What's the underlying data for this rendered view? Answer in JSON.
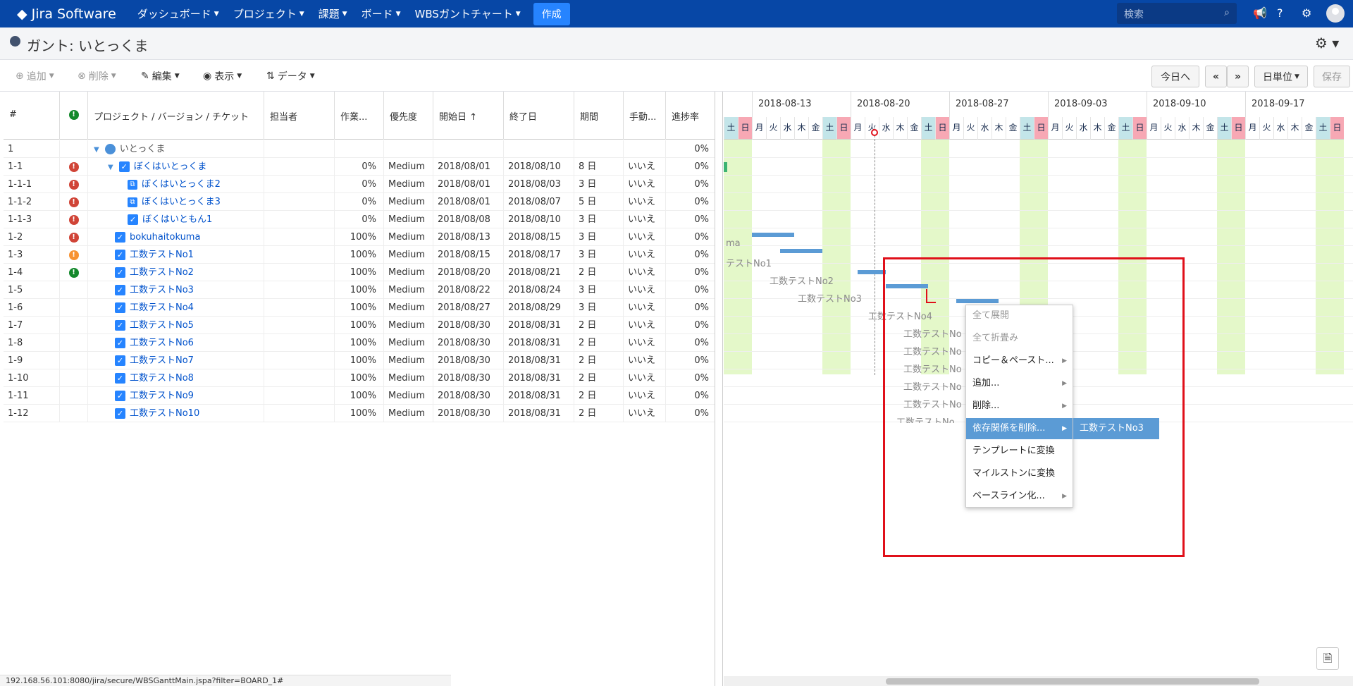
{
  "nav": {
    "logo": "Jira Software",
    "menu": [
      "ダッシュボード",
      "プロジェクト",
      "課題",
      "ボード",
      "WBSガントチャート"
    ],
    "create": "作成",
    "search_placeholder": "検索"
  },
  "page": {
    "title": "ガント: いとっくま"
  },
  "toolbar": {
    "add": "追加",
    "delete": "削除",
    "edit": "編集",
    "view": "表示",
    "data": "データ",
    "today": "今日へ",
    "prev": "«",
    "next": "»",
    "unit": "日単位",
    "save": "保存"
  },
  "grid": {
    "headers": [
      "#",
      "",
      "プロジェクト / バージョン / チケット",
      "担当者",
      "作業...",
      "優先度",
      "開始日",
      "終了日",
      "期間",
      "手動...",
      "進捗率"
    ],
    "rows": [
      {
        "num": "1",
        "name": "いとっくま",
        "work": "",
        "priority": "",
        "start": "",
        "end": "",
        "dur": "",
        "manual": "",
        "progress": "0%"
      },
      {
        "num": "1-1",
        "name": "ぼくはいとっくま",
        "work": "0%",
        "priority": "Medium",
        "start": "2018/08/01",
        "end": "2018/08/10",
        "dur": "8 日",
        "manual": "いいえ",
        "progress": "0%"
      },
      {
        "num": "1-1-1",
        "name": "ぼくはいとっくま2",
        "work": "0%",
        "priority": "Medium",
        "start": "2018/08/01",
        "end": "2018/08/03",
        "dur": "3 日",
        "manual": "いいえ",
        "progress": "0%"
      },
      {
        "num": "1-1-2",
        "name": "ぼくはいとっくま3",
        "work": "0%",
        "priority": "Medium",
        "start": "2018/08/01",
        "end": "2018/08/07",
        "dur": "5 日",
        "manual": "いいえ",
        "progress": "0%"
      },
      {
        "num": "1-1-3",
        "name": "ぼくはいともん1",
        "work": "0%",
        "priority": "Medium",
        "start": "2018/08/08",
        "end": "2018/08/10",
        "dur": "3 日",
        "manual": "いいえ",
        "progress": "0%"
      },
      {
        "num": "1-2",
        "name": "bokuhaitokuma",
        "work": "100%",
        "priority": "Medium",
        "start": "2018/08/13",
        "end": "2018/08/15",
        "dur": "3 日",
        "manual": "いいえ",
        "progress": "0%"
      },
      {
        "num": "1-3",
        "name": "工数テストNo1",
        "work": "100%",
        "priority": "Medium",
        "start": "2018/08/15",
        "end": "2018/08/17",
        "dur": "3 日",
        "manual": "いいえ",
        "progress": "0%"
      },
      {
        "num": "1-4",
        "name": "工数テストNo2",
        "work": "100%",
        "priority": "Medium",
        "start": "2018/08/20",
        "end": "2018/08/21",
        "dur": "2 日",
        "manual": "いいえ",
        "progress": "0%"
      },
      {
        "num": "1-5",
        "name": "工数テストNo3",
        "work": "100%",
        "priority": "Medium",
        "start": "2018/08/22",
        "end": "2018/08/24",
        "dur": "3 日",
        "manual": "いいえ",
        "progress": "0%"
      },
      {
        "num": "1-6",
        "name": "工数テストNo4",
        "work": "100%",
        "priority": "Medium",
        "start": "2018/08/27",
        "end": "2018/08/29",
        "dur": "3 日",
        "manual": "いいえ",
        "progress": "0%"
      },
      {
        "num": "1-7",
        "name": "工数テストNo5",
        "work": "100%",
        "priority": "Medium",
        "start": "2018/08/30",
        "end": "2018/08/31",
        "dur": "2 日",
        "manual": "いいえ",
        "progress": "0%"
      },
      {
        "num": "1-8",
        "name": "工数テストNo6",
        "work": "100%",
        "priority": "Medium",
        "start": "2018/08/30",
        "end": "2018/08/31",
        "dur": "2 日",
        "manual": "いいえ",
        "progress": "0%"
      },
      {
        "num": "1-9",
        "name": "工数テストNo7",
        "work": "100%",
        "priority": "Medium",
        "start": "2018/08/30",
        "end": "2018/08/31",
        "dur": "2 日",
        "manual": "いいえ",
        "progress": "0%"
      },
      {
        "num": "1-10",
        "name": "工数テストNo8",
        "work": "100%",
        "priority": "Medium",
        "start": "2018/08/30",
        "end": "2018/08/31",
        "dur": "2 日",
        "manual": "いいえ",
        "progress": "0%"
      },
      {
        "num": "1-11",
        "name": "工数テストNo9",
        "work": "100%",
        "priority": "Medium",
        "start": "2018/08/30",
        "end": "2018/08/31",
        "dur": "2 日",
        "manual": "いいえ",
        "progress": "0%"
      },
      {
        "num": "1-12",
        "name": "工数テストNo10",
        "work": "100%",
        "priority": "Medium",
        "start": "2018/08/30",
        "end": "2018/08/31",
        "dur": "2 日",
        "manual": "いいえ",
        "progress": "0%"
      }
    ]
  },
  "gantt": {
    "weeks": [
      "2018-08-13",
      "2018-08-20",
      "2018-08-27",
      "2018-09-03",
      "2018-09-10",
      "2018-09-17"
    ],
    "days": [
      "土",
      "日",
      "月",
      "火",
      "水",
      "木",
      "金",
      "土",
      "日",
      "月",
      "火",
      "水",
      "木",
      "金",
      "土",
      "日",
      "月",
      "火",
      "水",
      "木",
      "金",
      "土",
      "日",
      "月",
      "火",
      "水",
      "木",
      "金",
      "土",
      "日",
      "月",
      "火",
      "水",
      "木",
      "金",
      "土",
      "日",
      "月",
      "火",
      "水",
      "木",
      "金",
      "土",
      "日"
    ],
    "labels": [
      "ma",
      "テストNo1",
      "工数テストNo2",
      "工数テストNo3",
      "工数テストNo4",
      "工数テストNo",
      "工数テストNo",
      "工数テストNo",
      "工数テストNo",
      "工数テストNo",
      "工数テストNo"
    ]
  },
  "context_menu": {
    "items": [
      "全て展開",
      "全て折畳み",
      "コピー＆ペースト...",
      "追加...",
      "削除...",
      "依存関係を削除...",
      "テンプレートに変換",
      "マイルストンに変換",
      "ベースライン化..."
    ],
    "submenu_item": "工数テストNo3"
  },
  "status_url": "192.168.56.101:8080/jira/secure/WBSGanttMain.jspa?filter=BOARD_1#"
}
